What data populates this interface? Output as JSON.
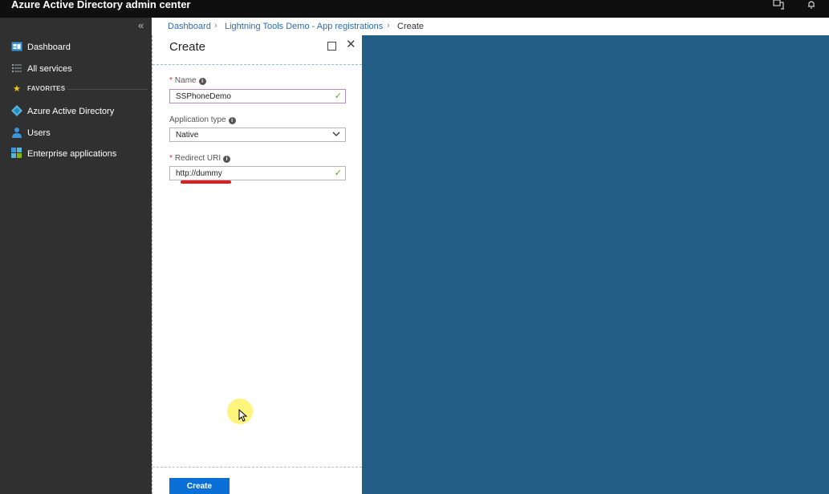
{
  "app": {
    "title": "Azure Active Directory admin center",
    "icons": [
      "feedback-icon",
      "notification-bell-icon"
    ]
  },
  "sidebar": {
    "collapse_glyph": "«",
    "items": [
      {
        "label": "Dashboard",
        "icon": "dashboard-icon"
      },
      {
        "label": "All services",
        "icon": "list-icon"
      }
    ],
    "favorites_label": "FAVORITES",
    "favorites": [
      {
        "label": "Azure Active Directory",
        "icon": "azure-ad-icon"
      },
      {
        "label": "Users",
        "icon": "users-icon"
      },
      {
        "label": "Enterprise applications",
        "icon": "enterprise-apps-icon"
      }
    ]
  },
  "breadcrumb": {
    "items": [
      "Dashboard",
      "Lightning Tools Demo - App registrations",
      "Create"
    ]
  },
  "blade": {
    "title": "Create",
    "fields": {
      "name": {
        "label": "Name",
        "value": "SSPhoneDemo",
        "required": true
      },
      "app_type": {
        "label": "Application type",
        "value": "Native"
      },
      "redirect_uri": {
        "label": "Redirect URI",
        "value": "http://dummy",
        "required": true
      }
    },
    "create_label": "Create"
  },
  "colors": {
    "accent": "#0a6fd6",
    "canvas": "#235f84",
    "sidebar": "#303030",
    "valid_check": "#5ca31a",
    "required": "#d13438"
  }
}
